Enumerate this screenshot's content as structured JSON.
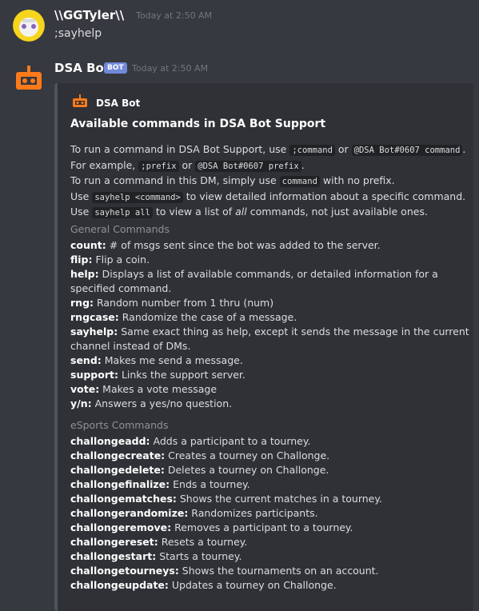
{
  "messages": [
    {
      "author": "\\\\GGTyler\\\\",
      "timestamp": "Today at 2:50 AM",
      "text": ";sayhelp"
    },
    {
      "author": "DSA Bot",
      "bot_tag": "BOT",
      "timestamp": "Today at 2:50 AM"
    }
  ],
  "embed": {
    "author": "DSA Bot",
    "title": "Available commands in DSA Bot Support",
    "desc": {
      "l1_a": "To run a command in DSA Bot Support, use ",
      "l1_code1": ";command",
      "l1_b": " or ",
      "l1_code2": "@DSA Bot#0607 command",
      "l1_c": ".",
      "l2_a": "For example, ",
      "l2_code1": ";prefix",
      "l2_b": " or ",
      "l2_code2": "@DSA Bot#0607 prefix",
      "l2_c": ".",
      "l3_a": "To run a command in this DM, simply use ",
      "l3_code": "command",
      "l3_b": " with no prefix.",
      "l4_a": "Use ",
      "l4_code": "sayhelp <command>",
      "l4_b": " to view detailed information about a specific command.",
      "l5_a": "Use ",
      "l5_code": "sayhelp all",
      "l5_b": " to view a list of ",
      "l5_em": "all",
      "l5_c": " commands, not just available ones."
    },
    "general": {
      "name": "General Commands",
      "items": [
        {
          "cmd": "count:",
          "text": " # of msgs sent since the bot was added to the server."
        },
        {
          "cmd": "flip:",
          "text": " Flip a coin."
        },
        {
          "cmd": "help:",
          "text": " Displays a list of available commands, or detailed information for a specified command."
        },
        {
          "cmd": "rng:",
          "text": " Random number from 1 thru (num)"
        },
        {
          "cmd": "rngcase:",
          "text": " Randomize the case of a message."
        },
        {
          "cmd": "sayhelp:",
          "text": " Same exact thing as help, except it sends the message in the current channel instead of DMs."
        },
        {
          "cmd": "send:",
          "text": " Makes me send a message."
        },
        {
          "cmd": "support:",
          "text": " Links the support server."
        },
        {
          "cmd": "vote:",
          "text": " Makes a vote message"
        },
        {
          "cmd": "y/n:",
          "text": " Answers a yes/no question."
        }
      ]
    },
    "esports": {
      "name": "eSports Commands",
      "items": [
        {
          "cmd": "challongeadd:",
          "text": " Adds a participant to a tourney."
        },
        {
          "cmd": "challongecreate:",
          "text": " Creates a tourney on Challonge."
        },
        {
          "cmd": "challongedelete:",
          "text": " Deletes a tourney on Challonge."
        },
        {
          "cmd": "challongefinalize:",
          "text": " Ends a tourney."
        },
        {
          "cmd": "challongematches:",
          "text": " Shows the current matches in a tourney."
        },
        {
          "cmd": "challongerandomize:",
          "text": " Randomizes participants."
        },
        {
          "cmd": "challongeremove:",
          "text": " Removes a participant to a tourney."
        },
        {
          "cmd": "challongereset:",
          "text": " Resets a tourney."
        },
        {
          "cmd": "challongestart:",
          "text": " Starts a tourney."
        },
        {
          "cmd": "challongetourneys:",
          "text": " Shows the tournaments on an account."
        },
        {
          "cmd": "challongeupdate:",
          "text": " Updates a tourney on Challonge."
        }
      ]
    }
  },
  "colors": {
    "background": "#36393f",
    "embed_bg": "#2f3136",
    "bot_tag": "#7289da",
    "avatar_user": "#f7d51d",
    "avatar_bot": "#ff7a1a"
  }
}
